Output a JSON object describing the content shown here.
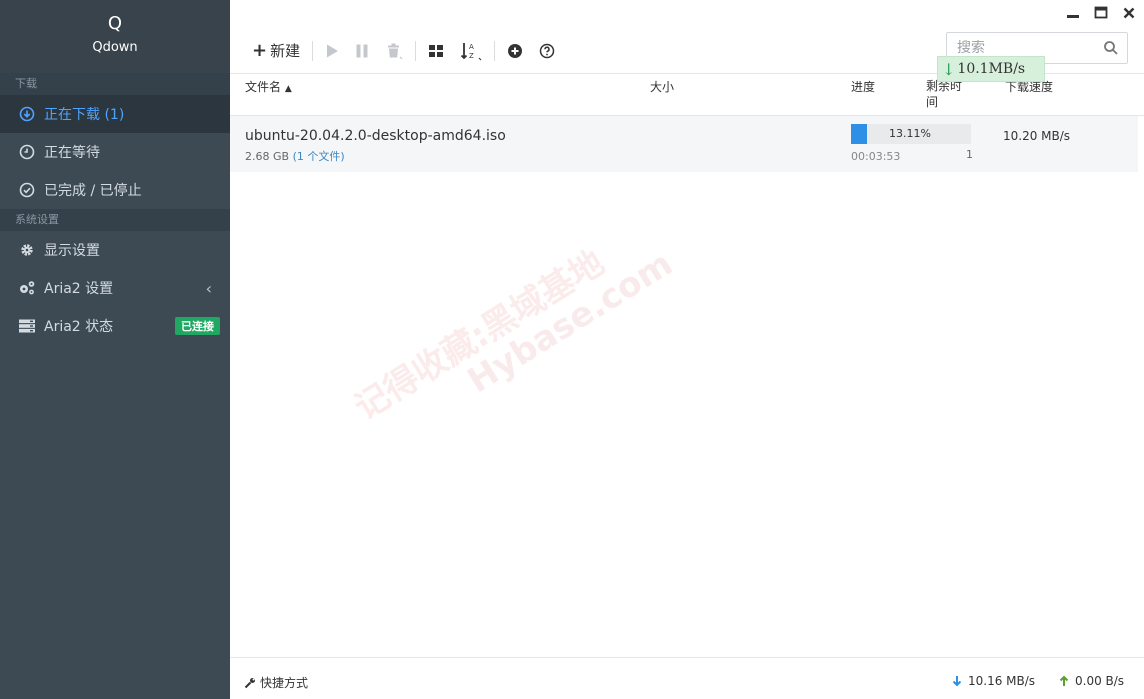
{
  "app": {
    "logo_letter": "Q",
    "name": "Qdown"
  },
  "sidebar": {
    "section_download": "下载",
    "items_download": [
      {
        "label": "正在下载 (1)",
        "icon": "download-circle-icon",
        "active": true
      },
      {
        "label": "正在等待",
        "icon": "clock-icon",
        "active": false
      },
      {
        "label": "已完成 / 已停止",
        "icon": "check-circle-icon",
        "active": false
      }
    ],
    "section_settings": "系统设置",
    "items_settings": [
      {
        "label": "显示设置",
        "icon": "gear-icon"
      },
      {
        "label": "Aria2 设置",
        "icon": "gears-icon",
        "chevron": "‹"
      },
      {
        "label": "Aria2 状态",
        "icon": "server-icon",
        "badge": "已连接"
      }
    ]
  },
  "toolbar": {
    "new_label": "新建",
    "search_placeholder": "搜索"
  },
  "speed_tooltip": {
    "arrow": "↓",
    "text": "10.1MB/s"
  },
  "table": {
    "headers": {
      "name": "文件名",
      "sort_indicator": "▲",
      "size": "大小",
      "progress": "进度",
      "remaining": "剩余时间",
      "speed": "下载速度"
    },
    "rows": [
      {
        "file_name": "ubuntu-20.04.2.0-desktop-amd64.iso",
        "file_size": "2.68 GB",
        "file_count": "(1 个文件)",
        "progress_text": "13.11%",
        "progress": 0.1311,
        "remaining": "00:03:53",
        "connections": "1",
        "speed": "10.20 MB/s"
      }
    ]
  },
  "watermark": {
    "line1": "记得收藏:黑域基地",
    "line2": "Hybase.com"
  },
  "statusbar": {
    "shortcut_label": "快捷方式",
    "download_speed": "10.16 MB/s",
    "upload_speed": "0.00 B/s"
  },
  "colors": {
    "sidebar_bg": "#3d4a54",
    "active_blue": "#4fa3ff",
    "progress_blue": "#2d8fe6",
    "badge_green": "#20a862",
    "upload_green": "#5a9e2f"
  }
}
